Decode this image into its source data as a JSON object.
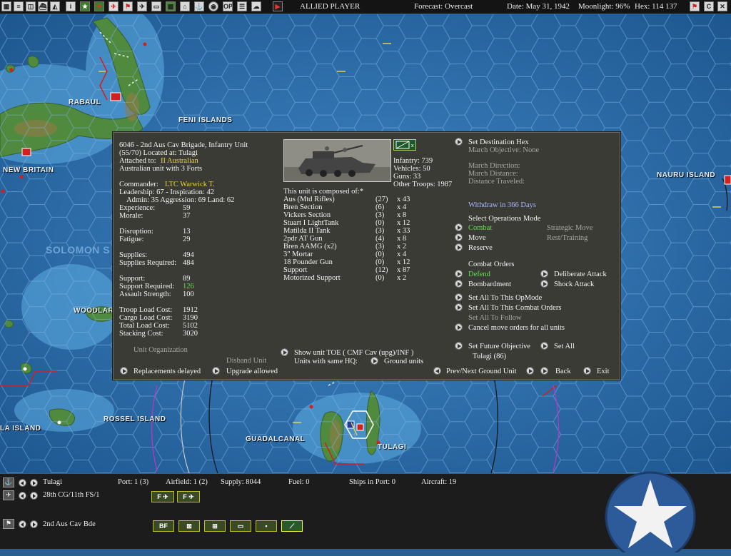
{
  "toolbar": {
    "left_icons": [
      "map-icon",
      "list-icon",
      "group-icon",
      "ship-icon",
      "info-icon",
      "star-icon",
      "plane-icon",
      "plane-red-icon",
      "flag-icon",
      "aircraft-icon",
      "truck-icon",
      "map-zoom-icon",
      "factory-icon",
      "ship2-icon",
      "globe-icon",
      "op-icon",
      "reports-icon",
      "cloud-icon"
    ],
    "op_label": "OP",
    "player": "ALLIED PLAYER",
    "forecast": "Forecast: Overcast",
    "date": "Date: May 31, 1942",
    "moonlight": "Moonlight: 96%",
    "hex": "Hex: 114 137",
    "c_label": "C"
  },
  "map": {
    "labels": {
      "rabaul": "RABAUL",
      "feni": "FENI ISLANDS",
      "new_britain": "NEW BRITAIN",
      "nauru": "NAURU ISLAND",
      "solomon": "SOLOMON S",
      "woodlark": "WOODLAR",
      "rossel": "ROSSEL ISLAND",
      "la_island": "LA ISLAND",
      "guadalcanal": "GUADALCANAL",
      "tulagi": "TULAGI"
    }
  },
  "panel": {
    "title_line1": "6046 - 2nd Aus Cav Brigade, Infantry Unit",
    "title_line2": "(55/70) Located at: Tulagi",
    "attached_label": "Attached to:",
    "attached_value": "II Australian",
    "forts_line": "Australian unit with 3 Forts",
    "commander_label": "Commander:",
    "commander_value": "LTC Warwick T.",
    "leadership_line": "Leadership: 67 - Inspiration: 42",
    "admin_line": "Admin: 35  Aggression: 69  Land: 62",
    "stats": [
      {
        "label": "Experience:",
        "value": "59"
      },
      {
        "label": "Morale:",
        "value": "37"
      },
      {
        "label": "Disruption:",
        "value": "13"
      },
      {
        "label": "Fatigue:",
        "value": "29"
      },
      {
        "label": "Supplies:",
        "value": "494"
      },
      {
        "label": "Supplies Required:",
        "value": "484"
      },
      {
        "label": "Support:",
        "value": "89"
      },
      {
        "label": "Support Required:",
        "value": "126"
      },
      {
        "label": "Assault Strength:",
        "value": "100"
      },
      {
        "label": "Troop Load Cost:",
        "value": "1912"
      },
      {
        "label": "Cargo Load Cost:",
        "value": "3190"
      },
      {
        "label": "Total Load Cost:",
        "value": "5102"
      },
      {
        "label": "Stacking Cost:",
        "value": "3020"
      }
    ],
    "unit_org": "Unit Organization",
    "disband": "Disband Unit",
    "replacements": "Replacements delayed",
    "upgrade": "Upgrade allowed",
    "infantry": "Infantry: 739",
    "vehicles": "Vehicles: 50",
    "guns": "Guns: 33",
    "other_troops": "Other Troops: 1987",
    "composed_title": "This unit is composed of:*",
    "components": [
      {
        "name": "Aus (Mtd Rifles)",
        "qty": "(27)",
        "count": "x 43"
      },
      {
        "name": "Bren Section",
        "qty": "(6)",
        "count": "x 4"
      },
      {
        "name": "Vickers Section",
        "qty": "(3)",
        "count": "x 8"
      },
      {
        "name": "Stuart I LightTank",
        "qty": "(0)",
        "count": "x 12"
      },
      {
        "name": "Matilda II Tank",
        "qty": "(3)",
        "count": "x 33"
      },
      {
        "name": "2pdr AT Gun",
        "qty": "(4)",
        "count": "x 8"
      },
      {
        "name": "Bren AAMG (x2)",
        "qty": "(3)",
        "count": "x 2"
      },
      {
        "name": "3\" Mortar",
        "qty": "(0)",
        "count": "x 4"
      },
      {
        "name": "18 Pounder Gun",
        "qty": "(0)",
        "count": "x 12"
      },
      {
        "name": "Support",
        "qty": "(12)",
        "count": "x 87"
      },
      {
        "name": "Motorized Support",
        "qty": "(0)",
        "count": "x 2"
      }
    ],
    "show_toe": "Show unit TOE ( CMF Cav (upg)/INF )",
    "same_hq": "Units with same HQ:",
    "ground_units": "Ground units",
    "set_destination": "Set Destination Hex",
    "march_objective": "March Objective: None",
    "march_direction": "March Direction:",
    "march_distance": "March Distance:",
    "distance_traveled": "Distance Traveled:",
    "withdraw": "Withdraw in 366 Days",
    "select_ops": "Select Operations Mode",
    "mode_combat": "Combat",
    "mode_strategic": "Strategic Move",
    "mode_move": "Move",
    "mode_rest": "Rest/Training",
    "mode_reserve": "Reserve",
    "combat_orders": "Combat Orders",
    "order_defend": "Defend",
    "order_deliberate": "Deliberate Attack",
    "order_bombard": "Bombardment",
    "order_shock": "Shock Attack",
    "set_all_opmode": "Set All To This OpMode",
    "set_all_combat": "Set All To This Combat Orders",
    "set_all_follow": "Set All To Follow",
    "cancel_move": "Cancel move orders for all units",
    "set_future": "Set Future Objective",
    "set_all": "Set All",
    "future_target": "Tulagi (86)",
    "prev_next": "Prev/Next Ground Unit",
    "back": "Back",
    "exit": "Exit"
  },
  "bottom": {
    "location": "Tulagi",
    "port": "Port: 1 (3)",
    "airfield": "Airfield: 1 (2)",
    "supply": "Supply: 8044",
    "fuel": "Fuel: 0",
    "ships_in_port": "Ships in Port: 0",
    "aircraft": "Aircraft: 19",
    "air_unit": "28th CG/11th FS/1",
    "ground_unit": "2nd Aus Cav Bde",
    "air_badge_1": "F",
    "air_badge_2": "F",
    "ground_badges": [
      "BF",
      "inf",
      "eng",
      "mot",
      "hq",
      "cav"
    ],
    "bf_label": "BF"
  }
}
